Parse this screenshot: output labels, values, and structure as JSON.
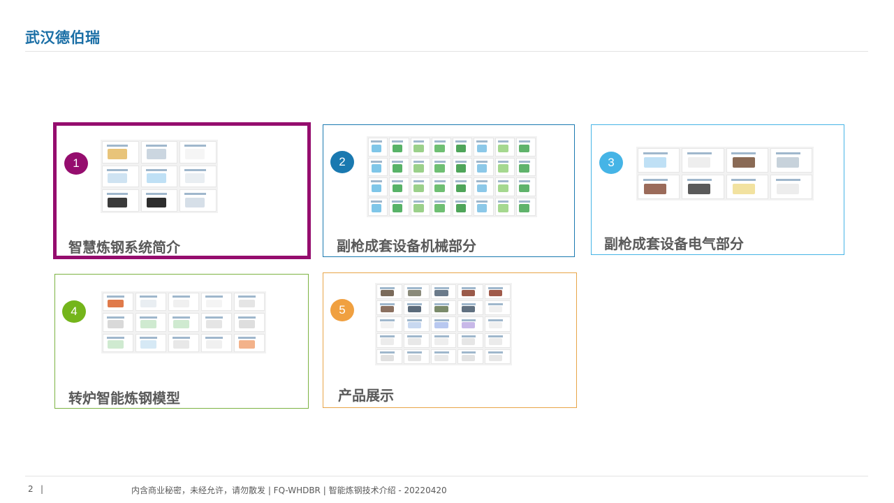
{
  "header": {
    "brand": "武汉德伯瑞"
  },
  "cards": [
    {
      "number": "1",
      "title": "智慧炼钢系统简介",
      "accent": "#950d6e"
    },
    {
      "number": "2",
      "title": "副枪成套设备机械部分",
      "accent": "#1a79b0"
    },
    {
      "number": "3",
      "title": "副枪成套设备电气部分",
      "accent": "#45b4e6"
    },
    {
      "number": "4",
      "title": "转炉智能炼钢模型",
      "accent": "#74b51b"
    },
    {
      "number": "5",
      "title": "产品展示",
      "accent": "#f0a040"
    }
  ],
  "footer": {
    "page_number": "2",
    "separator": "|",
    "text": "内含商业秘密，未经允许，请勿散发 | FQ-WHDBR | 智能炼钢技术介绍 - 20220420"
  }
}
